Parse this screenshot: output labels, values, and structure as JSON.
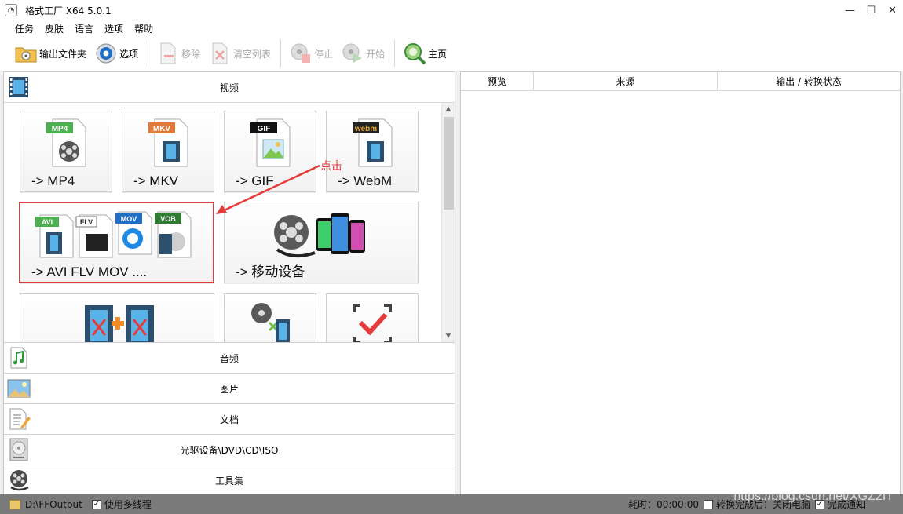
{
  "window": {
    "title": "格式工厂 X64 5.0.1",
    "controls": [
      "—",
      "☐",
      "✕"
    ]
  },
  "menu": [
    "任务",
    "皮肤",
    "语言",
    "选项",
    "帮助"
  ],
  "toolbar": {
    "output_folder": "输出文件夹",
    "options": "选项",
    "remove": "移除",
    "clear_list": "清空列表",
    "stop": "停止",
    "start": "开始",
    "home": "主页"
  },
  "left_panel": {
    "video_header": "视频",
    "tiles": [
      {
        "label": "-> MP4",
        "badge": "MP4",
        "badge_color": "#4caf50"
      },
      {
        "label": "-> MKV",
        "badge": "MKV",
        "badge_color": "#e07a3a"
      },
      {
        "label": "-> GIF",
        "badge": "GIF",
        "badge_color": "#111111"
      },
      {
        "label": "-> WebM",
        "badge": "webm",
        "badge_color": "#e8a23a"
      },
      {
        "label": "-> AVI FLV MOV ....",
        "badges": [
          "AVI",
          "FLV",
          "MOV",
          "VOB"
        ]
      },
      {
        "label": "-> 移动设备"
      }
    ],
    "click_annotation": "点击",
    "categories": [
      "音频",
      "图片",
      "文档",
      "光驱设备\\DVD\\CD\\ISO",
      "工具集"
    ]
  },
  "right_panel": {
    "columns": [
      "预览",
      "来源",
      "输出 / 转换状态"
    ]
  },
  "status": {
    "output_path": "D:\\FFOutput",
    "multithread": "使用多线程",
    "elapsed": "耗时：00:00:00",
    "after_convert": "转换完成后：关闭电脑",
    "notify": "完成通知",
    "watermark": "https://blog.csdn.net/XGZ2IT"
  },
  "colors": {
    "accent_red": "#e53b3b",
    "status_bar": "#7a7a7a"
  }
}
